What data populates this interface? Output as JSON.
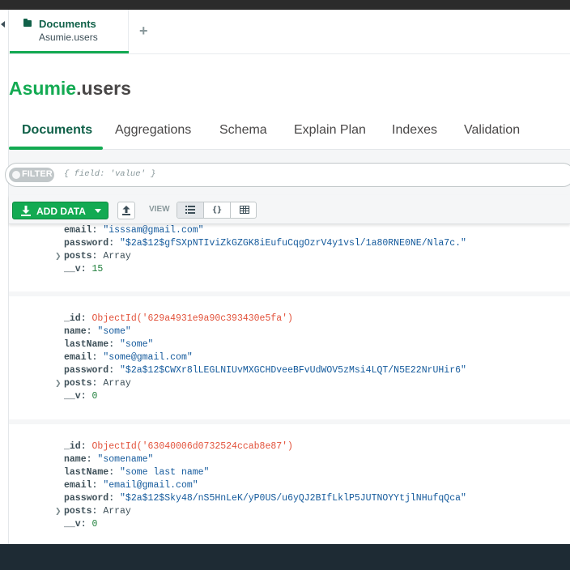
{
  "workspace_tab": {
    "title": "Documents",
    "subtitle": "Asumie.users",
    "folder_icon": "folder-icon",
    "new_tab_glyph": "+"
  },
  "namespace": {
    "db": "Asumie",
    "collection": ".users"
  },
  "sub_tabs": [
    "Documents",
    "Aggregations",
    "Schema",
    "Explain Plan",
    "Indexes",
    "Validation"
  ],
  "filter": {
    "pill_label": "FILTER",
    "placeholder": "{ field: 'value' }"
  },
  "toolbar": {
    "add_data_label": "ADD DATA",
    "view_label": "VIEW",
    "view_modes": [
      "list-view-icon",
      "json-view-icon",
      "table-view-icon"
    ],
    "json_glyph": "{}"
  },
  "documents": [
    {
      "email": "\"isssam@gmail.com\"",
      "password": "\"$2a$12$gfSXpNTIviZkGZGK8iEufuCqgOzrV4y1vsl/1a80RNE0NE/Nla7c.\"",
      "posts": "Array",
      "v": "15"
    },
    {
      "id": "ObjectId('629a4931e9a90c393430e5fa')",
      "name": "\"some\"",
      "lastName": "\"some\"",
      "email": "\"some@gmail.com\"",
      "password": "\"$2a$12$CWXr8lLEGLNIUvMXGCHDveeBFvUdWOV5zMsi4LQT/N5E22NrUHir6\"",
      "posts": "Array",
      "v": "0"
    },
    {
      "id": "ObjectId('63040006d0732524ccab8e87')",
      "name": "\"somename\"",
      "lastName": "\"some last name\"",
      "email": "\"email@gmail.com\"",
      "password": "\"$2a$12$Sky48/nS5HnLeK/yP0US/u6yQJ2BIfLklP5JUTNOYYtjlNHufqQca\"",
      "posts": "Array",
      "v": "0"
    }
  ],
  "field_keys": {
    "id": "_id:",
    "name": "name:",
    "lastName": "lastName:",
    "email": "email:",
    "password": "password:",
    "posts": "posts:",
    "v": "__v:"
  },
  "colors": {
    "accent_green": "#13aa52",
    "dark_green": "#116149",
    "string_value": "#145a9c",
    "objectid_value": "#e2523b",
    "number_value": "#1e7e3a"
  }
}
